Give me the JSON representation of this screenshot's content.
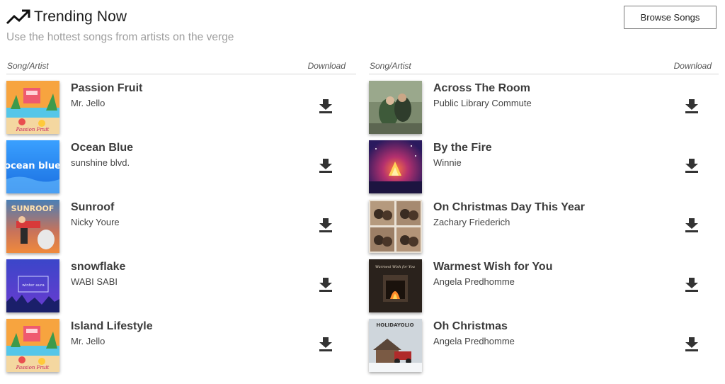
{
  "header": {
    "title": "Trending Now",
    "subtitle": "Use the hottest songs from artists on the verge",
    "browse_label": "Browse Songs",
    "icon": "trending-up-icon"
  },
  "columns": [
    {
      "headers": {
        "song": "Song/Artist",
        "download": "Download"
      },
      "songs": [
        {
          "title": "Passion Fruit",
          "artist": "Mr. Jello",
          "cover_text": "Passion Fruit"
        },
        {
          "title": "Ocean Blue",
          "artist": "sunshine blvd.",
          "cover_text": "ocean blue"
        },
        {
          "title": "Sunroof",
          "artist": "Nicky Youre",
          "cover_text": "SUNROOF"
        },
        {
          "title": "snowflake",
          "artist": "WABI SABI",
          "cover_text": "winter aura"
        },
        {
          "title": "Island Lifestyle",
          "artist": "Mr. Jello",
          "cover_text": "Passion Fruit"
        }
      ]
    },
    {
      "headers": {
        "song": "Song/Artist",
        "download": "Download"
      },
      "songs": [
        {
          "title": "Across The Room",
          "artist": "Public Library Commute"
        },
        {
          "title": "By the Fire",
          "artist": "Winnie"
        },
        {
          "title": "On Christmas Day This Year",
          "artist": "Zachary Friederich"
        },
        {
          "title": "Warmest Wish for You",
          "artist": "Angela Predhomme",
          "cover_text": "Warmest Wish for You"
        },
        {
          "title": "Oh Christmas",
          "artist": "Angela Predhomme",
          "cover_text": "HOLIDAYOLIO"
        }
      ]
    }
  ]
}
